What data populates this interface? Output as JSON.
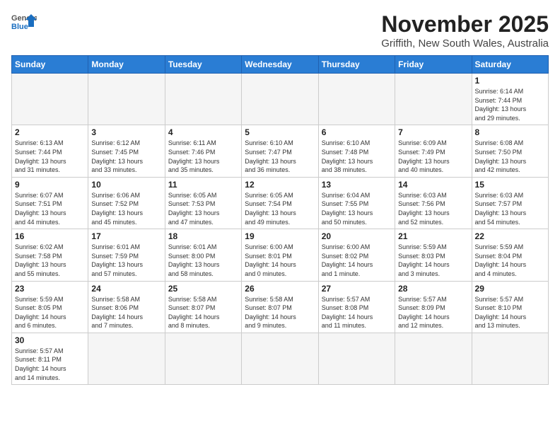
{
  "header": {
    "logo_line1": "General",
    "logo_line2": "Blue",
    "month_year": "November 2025",
    "location": "Griffith, New South Wales, Australia"
  },
  "weekdays": [
    "Sunday",
    "Monday",
    "Tuesday",
    "Wednesday",
    "Thursday",
    "Friday",
    "Saturday"
  ],
  "weeks": [
    [
      {
        "day": "",
        "info": ""
      },
      {
        "day": "",
        "info": ""
      },
      {
        "day": "",
        "info": ""
      },
      {
        "day": "",
        "info": ""
      },
      {
        "day": "",
        "info": ""
      },
      {
        "day": "",
        "info": ""
      },
      {
        "day": "1",
        "info": "Sunrise: 6:14 AM\nSunset: 7:44 PM\nDaylight: 13 hours\nand 29 minutes."
      }
    ],
    [
      {
        "day": "2",
        "info": "Sunrise: 6:13 AM\nSunset: 7:44 PM\nDaylight: 13 hours\nand 31 minutes."
      },
      {
        "day": "3",
        "info": "Sunrise: 6:12 AM\nSunset: 7:45 PM\nDaylight: 13 hours\nand 33 minutes."
      },
      {
        "day": "4",
        "info": "Sunrise: 6:11 AM\nSunset: 7:46 PM\nDaylight: 13 hours\nand 35 minutes."
      },
      {
        "day": "5",
        "info": "Sunrise: 6:10 AM\nSunset: 7:47 PM\nDaylight: 13 hours\nand 36 minutes."
      },
      {
        "day": "6",
        "info": "Sunrise: 6:10 AM\nSunset: 7:48 PM\nDaylight: 13 hours\nand 38 minutes."
      },
      {
        "day": "7",
        "info": "Sunrise: 6:09 AM\nSunset: 7:49 PM\nDaylight: 13 hours\nand 40 minutes."
      },
      {
        "day": "8",
        "info": "Sunrise: 6:08 AM\nSunset: 7:50 PM\nDaylight: 13 hours\nand 42 minutes."
      }
    ],
    [
      {
        "day": "9",
        "info": "Sunrise: 6:07 AM\nSunset: 7:51 PM\nDaylight: 13 hours\nand 44 minutes."
      },
      {
        "day": "10",
        "info": "Sunrise: 6:06 AM\nSunset: 7:52 PM\nDaylight: 13 hours\nand 45 minutes."
      },
      {
        "day": "11",
        "info": "Sunrise: 6:05 AM\nSunset: 7:53 PM\nDaylight: 13 hours\nand 47 minutes."
      },
      {
        "day": "12",
        "info": "Sunrise: 6:05 AM\nSunset: 7:54 PM\nDaylight: 13 hours\nand 49 minutes."
      },
      {
        "day": "13",
        "info": "Sunrise: 6:04 AM\nSunset: 7:55 PM\nDaylight: 13 hours\nand 50 minutes."
      },
      {
        "day": "14",
        "info": "Sunrise: 6:03 AM\nSunset: 7:56 PM\nDaylight: 13 hours\nand 52 minutes."
      },
      {
        "day": "15",
        "info": "Sunrise: 6:03 AM\nSunset: 7:57 PM\nDaylight: 13 hours\nand 54 minutes."
      }
    ],
    [
      {
        "day": "16",
        "info": "Sunrise: 6:02 AM\nSunset: 7:58 PM\nDaylight: 13 hours\nand 55 minutes."
      },
      {
        "day": "17",
        "info": "Sunrise: 6:01 AM\nSunset: 7:59 PM\nDaylight: 13 hours\nand 57 minutes."
      },
      {
        "day": "18",
        "info": "Sunrise: 6:01 AM\nSunset: 8:00 PM\nDaylight: 13 hours\nand 58 minutes."
      },
      {
        "day": "19",
        "info": "Sunrise: 6:00 AM\nSunset: 8:01 PM\nDaylight: 14 hours\nand 0 minutes."
      },
      {
        "day": "20",
        "info": "Sunrise: 6:00 AM\nSunset: 8:02 PM\nDaylight: 14 hours\nand 1 minute."
      },
      {
        "day": "21",
        "info": "Sunrise: 5:59 AM\nSunset: 8:03 PM\nDaylight: 14 hours\nand 3 minutes."
      },
      {
        "day": "22",
        "info": "Sunrise: 5:59 AM\nSunset: 8:04 PM\nDaylight: 14 hours\nand 4 minutes."
      }
    ],
    [
      {
        "day": "23",
        "info": "Sunrise: 5:59 AM\nSunset: 8:05 PM\nDaylight: 14 hours\nand 6 minutes."
      },
      {
        "day": "24",
        "info": "Sunrise: 5:58 AM\nSunset: 8:06 PM\nDaylight: 14 hours\nand 7 minutes."
      },
      {
        "day": "25",
        "info": "Sunrise: 5:58 AM\nSunset: 8:07 PM\nDaylight: 14 hours\nand 8 minutes."
      },
      {
        "day": "26",
        "info": "Sunrise: 5:58 AM\nSunset: 8:07 PM\nDaylight: 14 hours\nand 9 minutes."
      },
      {
        "day": "27",
        "info": "Sunrise: 5:57 AM\nSunset: 8:08 PM\nDaylight: 14 hours\nand 11 minutes."
      },
      {
        "day": "28",
        "info": "Sunrise: 5:57 AM\nSunset: 8:09 PM\nDaylight: 14 hours\nand 12 minutes."
      },
      {
        "day": "29",
        "info": "Sunrise: 5:57 AM\nSunset: 8:10 PM\nDaylight: 14 hours\nand 13 minutes."
      }
    ],
    [
      {
        "day": "30",
        "info": "Sunrise: 5:57 AM\nSunset: 8:11 PM\nDaylight: 14 hours\nand 14 minutes."
      },
      {
        "day": "",
        "info": ""
      },
      {
        "day": "",
        "info": ""
      },
      {
        "day": "",
        "info": ""
      },
      {
        "day": "",
        "info": ""
      },
      {
        "day": "",
        "info": ""
      },
      {
        "day": "",
        "info": ""
      }
    ]
  ]
}
